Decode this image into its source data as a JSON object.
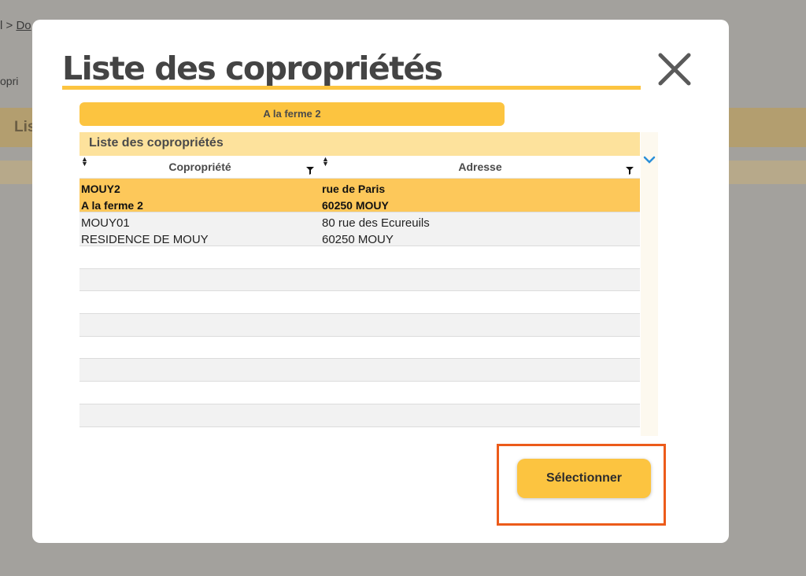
{
  "background": {
    "breadcrumb_sep": "l >",
    "breadcrumb_link": "Do",
    "subtitle_fragment": "opri",
    "header_fragment": "Lis"
  },
  "modal": {
    "title": "Liste des copropriétés",
    "close_icon": "close-x-icon",
    "selected_label": "A la ferme 2",
    "table": {
      "caption": "Liste des copropriétés",
      "columns": [
        "Copropriété",
        "Adresse"
      ],
      "rows": [
        {
          "copropriete_line1": "MOUY2",
          "copropriete_line2": "A la ferme 2",
          "adresse_line1": "rue de Paris",
          "adresse_line2": "60250 MOUY",
          "selected": true
        },
        {
          "copropriete_line1": "MOUY01",
          "copropriete_line2": "RESIDENCE DE MOUY",
          "adresse_line1": "80 rue des Ecureuils",
          "adresse_line2": "60250 MOUY",
          "selected": false
        }
      ]
    },
    "select_button": "Sélectionner"
  },
  "colors": {
    "accent": "#fcc440",
    "highlight": "#ec5b1a",
    "overlay": "#a3a19d"
  }
}
